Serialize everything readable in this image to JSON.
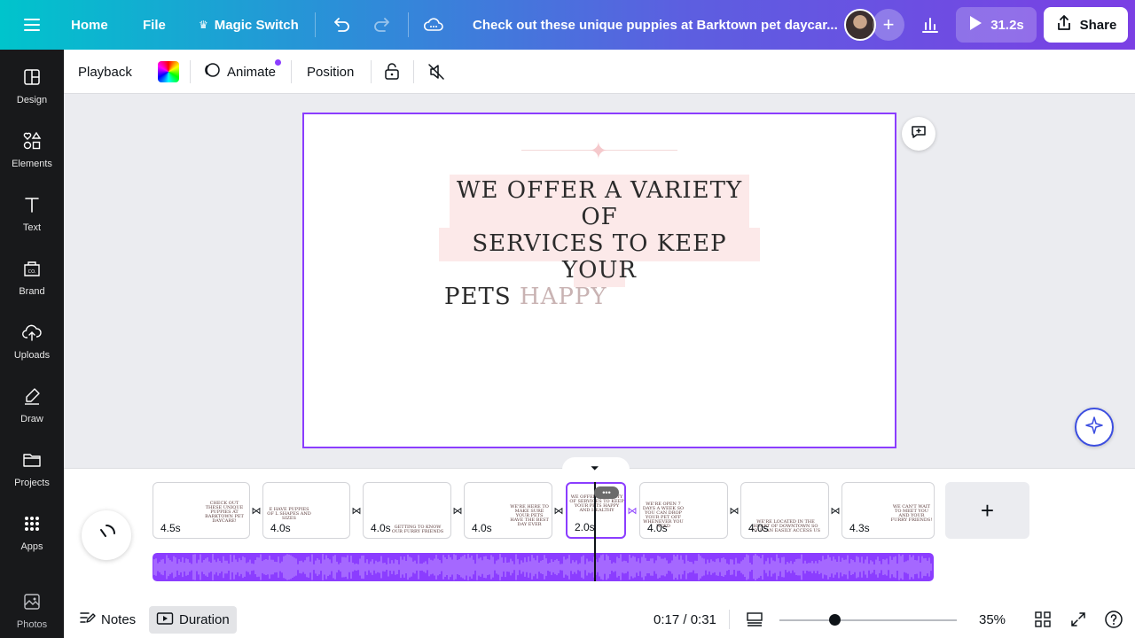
{
  "topbar": {
    "home": "Home",
    "file": "File",
    "magic_switch": "Magic Switch",
    "doc_title": "Check out these unique puppies at Barktown pet daycar...",
    "play_duration": "31.2s",
    "share": "Share"
  },
  "sidebar": {
    "items": [
      {
        "label": "Design"
      },
      {
        "label": "Elements"
      },
      {
        "label": "Text"
      },
      {
        "label": "Brand"
      },
      {
        "label": "Uploads"
      },
      {
        "label": "Draw"
      },
      {
        "label": "Projects"
      },
      {
        "label": "Apps"
      },
      {
        "label": "Photos"
      }
    ]
  },
  "toolbar": {
    "playback": "Playback",
    "animate": "Animate",
    "position": "Position"
  },
  "canvas": {
    "headline_line1": "WE OFFER A VARIETY OF",
    "headline_line2": "SERVICES TO KEEP YOUR",
    "headline_line3a": "PETS ",
    "headline_line3b": "HAPPY"
  },
  "timeline": {
    "clips": [
      {
        "duration": "4.5s",
        "text": "CHECK OUT THESE UNIQUE PUPPIES AT BARKTOWN PET DAYCARE!"
      },
      {
        "duration": "4.0s",
        "text": "E HAVE PUPPIES OF L SHAPES AND SIZES"
      },
      {
        "duration": "4.0s",
        "text": "GETTING TO KNOW OUR FURRY FRIENDS"
      },
      {
        "duration": "4.0s",
        "text": "WE'RE HERE TO MAKE SURE YOUR PETS HAVE THE BEST DAY EVER"
      },
      {
        "duration": "2.0s",
        "text": "WE OFFER A VARIETY OF SERVICES TO KEEP YOUR PETS HAPPY AND HEALTHY"
      },
      {
        "duration": "4.0s",
        "text": "WE'RE OPEN 7 DAYS A WEEK SO YOU CAN DROP YOUR PET OFF WHENEVER YOU NEED"
      },
      {
        "duration": "4.0s",
        "text": "WE'RE LOCATED IN THE HEART OF DOWNTOWN SO YOU CAN EASILY ACCESS US"
      },
      {
        "duration": "4.3s",
        "text": "WE CAN'T WAIT TO MEET YOU AND YOUR FURRY FRIENDS!"
      }
    ]
  },
  "bottombar": {
    "notes": "Notes",
    "duration": "Duration",
    "time": "0:17 / 0:31",
    "zoom": "35%"
  },
  "colors": {
    "accent": "#8b3dff",
    "sidebar_bg": "#18191b",
    "headline_bg": "#fce9e9"
  }
}
